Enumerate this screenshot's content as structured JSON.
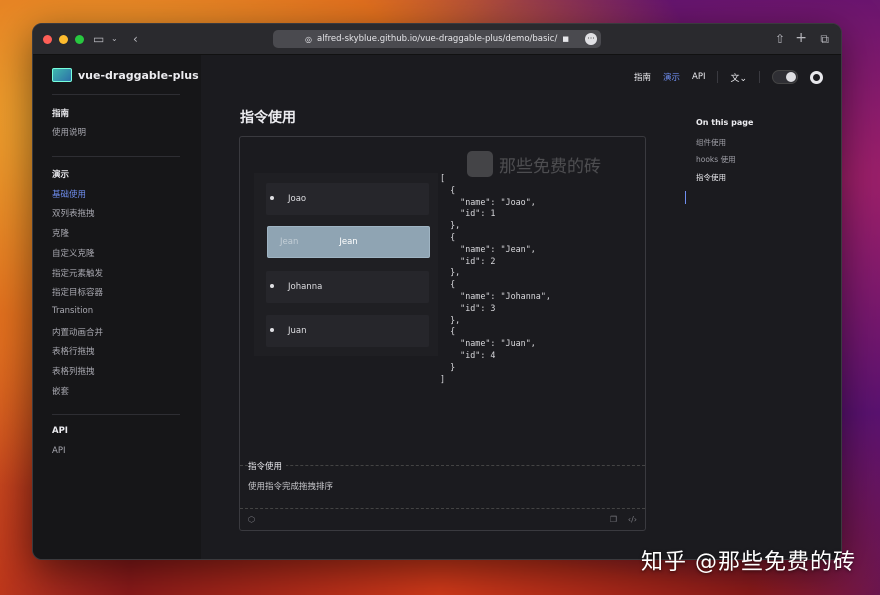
{
  "browser": {
    "url": "alfred-skyblue.github.io/vue-draggable-plus/demo/basic/"
  },
  "site": {
    "name": "vue-draggable-plus"
  },
  "nav": {
    "guide": "指南",
    "demo": "演示",
    "api": "API"
  },
  "sidebar": {
    "sections": [
      {
        "title": "指南",
        "items": [
          "使用说明"
        ]
      },
      {
        "title": "演示",
        "items": [
          "基础使用",
          "双列表拖拽",
          "克隆",
          "自定义克隆",
          "指定元素触发",
          "指定目标容器",
          "Transition",
          "内置动画合并",
          "表格行拖拽",
          "表格列拖拽",
          "嵌套"
        ]
      },
      {
        "title": "API",
        "items": [
          "API"
        ]
      }
    ],
    "active_item": "基础使用"
  },
  "page": {
    "title": "指令使用"
  },
  "demo": {
    "items": [
      {
        "name": "Joao",
        "id": 1
      },
      {
        "name": "Jean",
        "id": 2
      },
      {
        "name": "Johanna",
        "id": 3
      },
      {
        "name": "Juan",
        "id": 4
      }
    ],
    "dragging_label": "Jean",
    "json_lines": [
      "[",
      "  {",
      "    \"name\": \"Joao\",",
      "    \"id\": 1",
      "  },",
      "  {",
      "    \"name\": \"Jean\",",
      "    \"id\": 2",
      "  },",
      "  {",
      "    \"name\": \"Johanna\",",
      "    \"id\": 3",
      "  },",
      "  {",
      "    \"name\": \"Juan\",",
      "    \"id\": 4",
      "  }",
      "]"
    ],
    "caption_title": "指令使用",
    "caption_desc": "使用指令完成拖拽排序",
    "watermark": "那些免费的砖"
  },
  "toc": {
    "title": "On this page",
    "items": [
      "组件使用",
      "hooks 使用",
      "指令使用"
    ],
    "active": "指令使用"
  },
  "overlay": {
    "zhihu": "知乎 @那些免费的砖"
  },
  "colors": {
    "accent": "#6f8ef0",
    "drag_item": "#8fa4b3"
  }
}
